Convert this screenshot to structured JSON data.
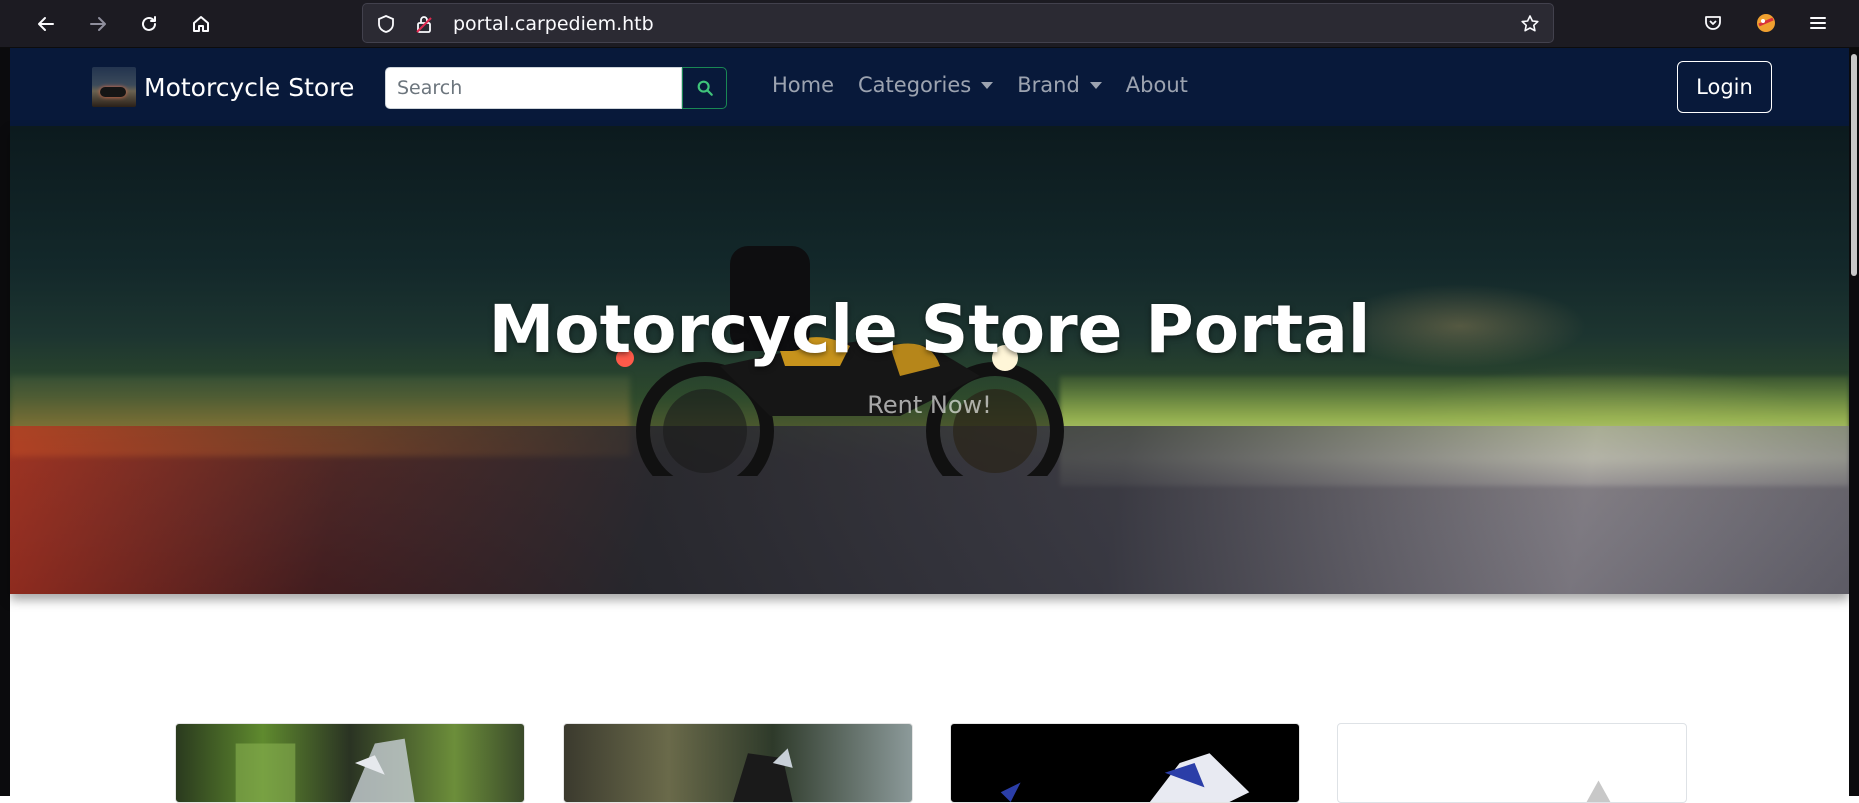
{
  "browser": {
    "url_host": "portal.carpediem.htb",
    "icons": {
      "back": "arrow-left-icon",
      "forward": "arrow-right-icon",
      "reload": "reload-icon",
      "home": "home-icon",
      "shield": "shield-icon",
      "insecure": "insecure-lock-icon",
      "bookmark": "star-icon",
      "pocket": "pocket-icon",
      "extension": "extension-icon",
      "menu": "hamburger-menu-icon"
    }
  },
  "navbar": {
    "brand": "Motorcycle Store",
    "search_placeholder": "Search",
    "search_icon": "search-icon",
    "links": [
      {
        "label": "Home"
      },
      {
        "label": "Categories"
      },
      {
        "label": "Brand"
      },
      {
        "label": "About"
      }
    ],
    "login_label": "Login",
    "background": "#08193a",
    "accent": "#198754"
  },
  "hero": {
    "title": "Motorcycle Store Portal",
    "subtitle": "Rent Now!"
  }
}
